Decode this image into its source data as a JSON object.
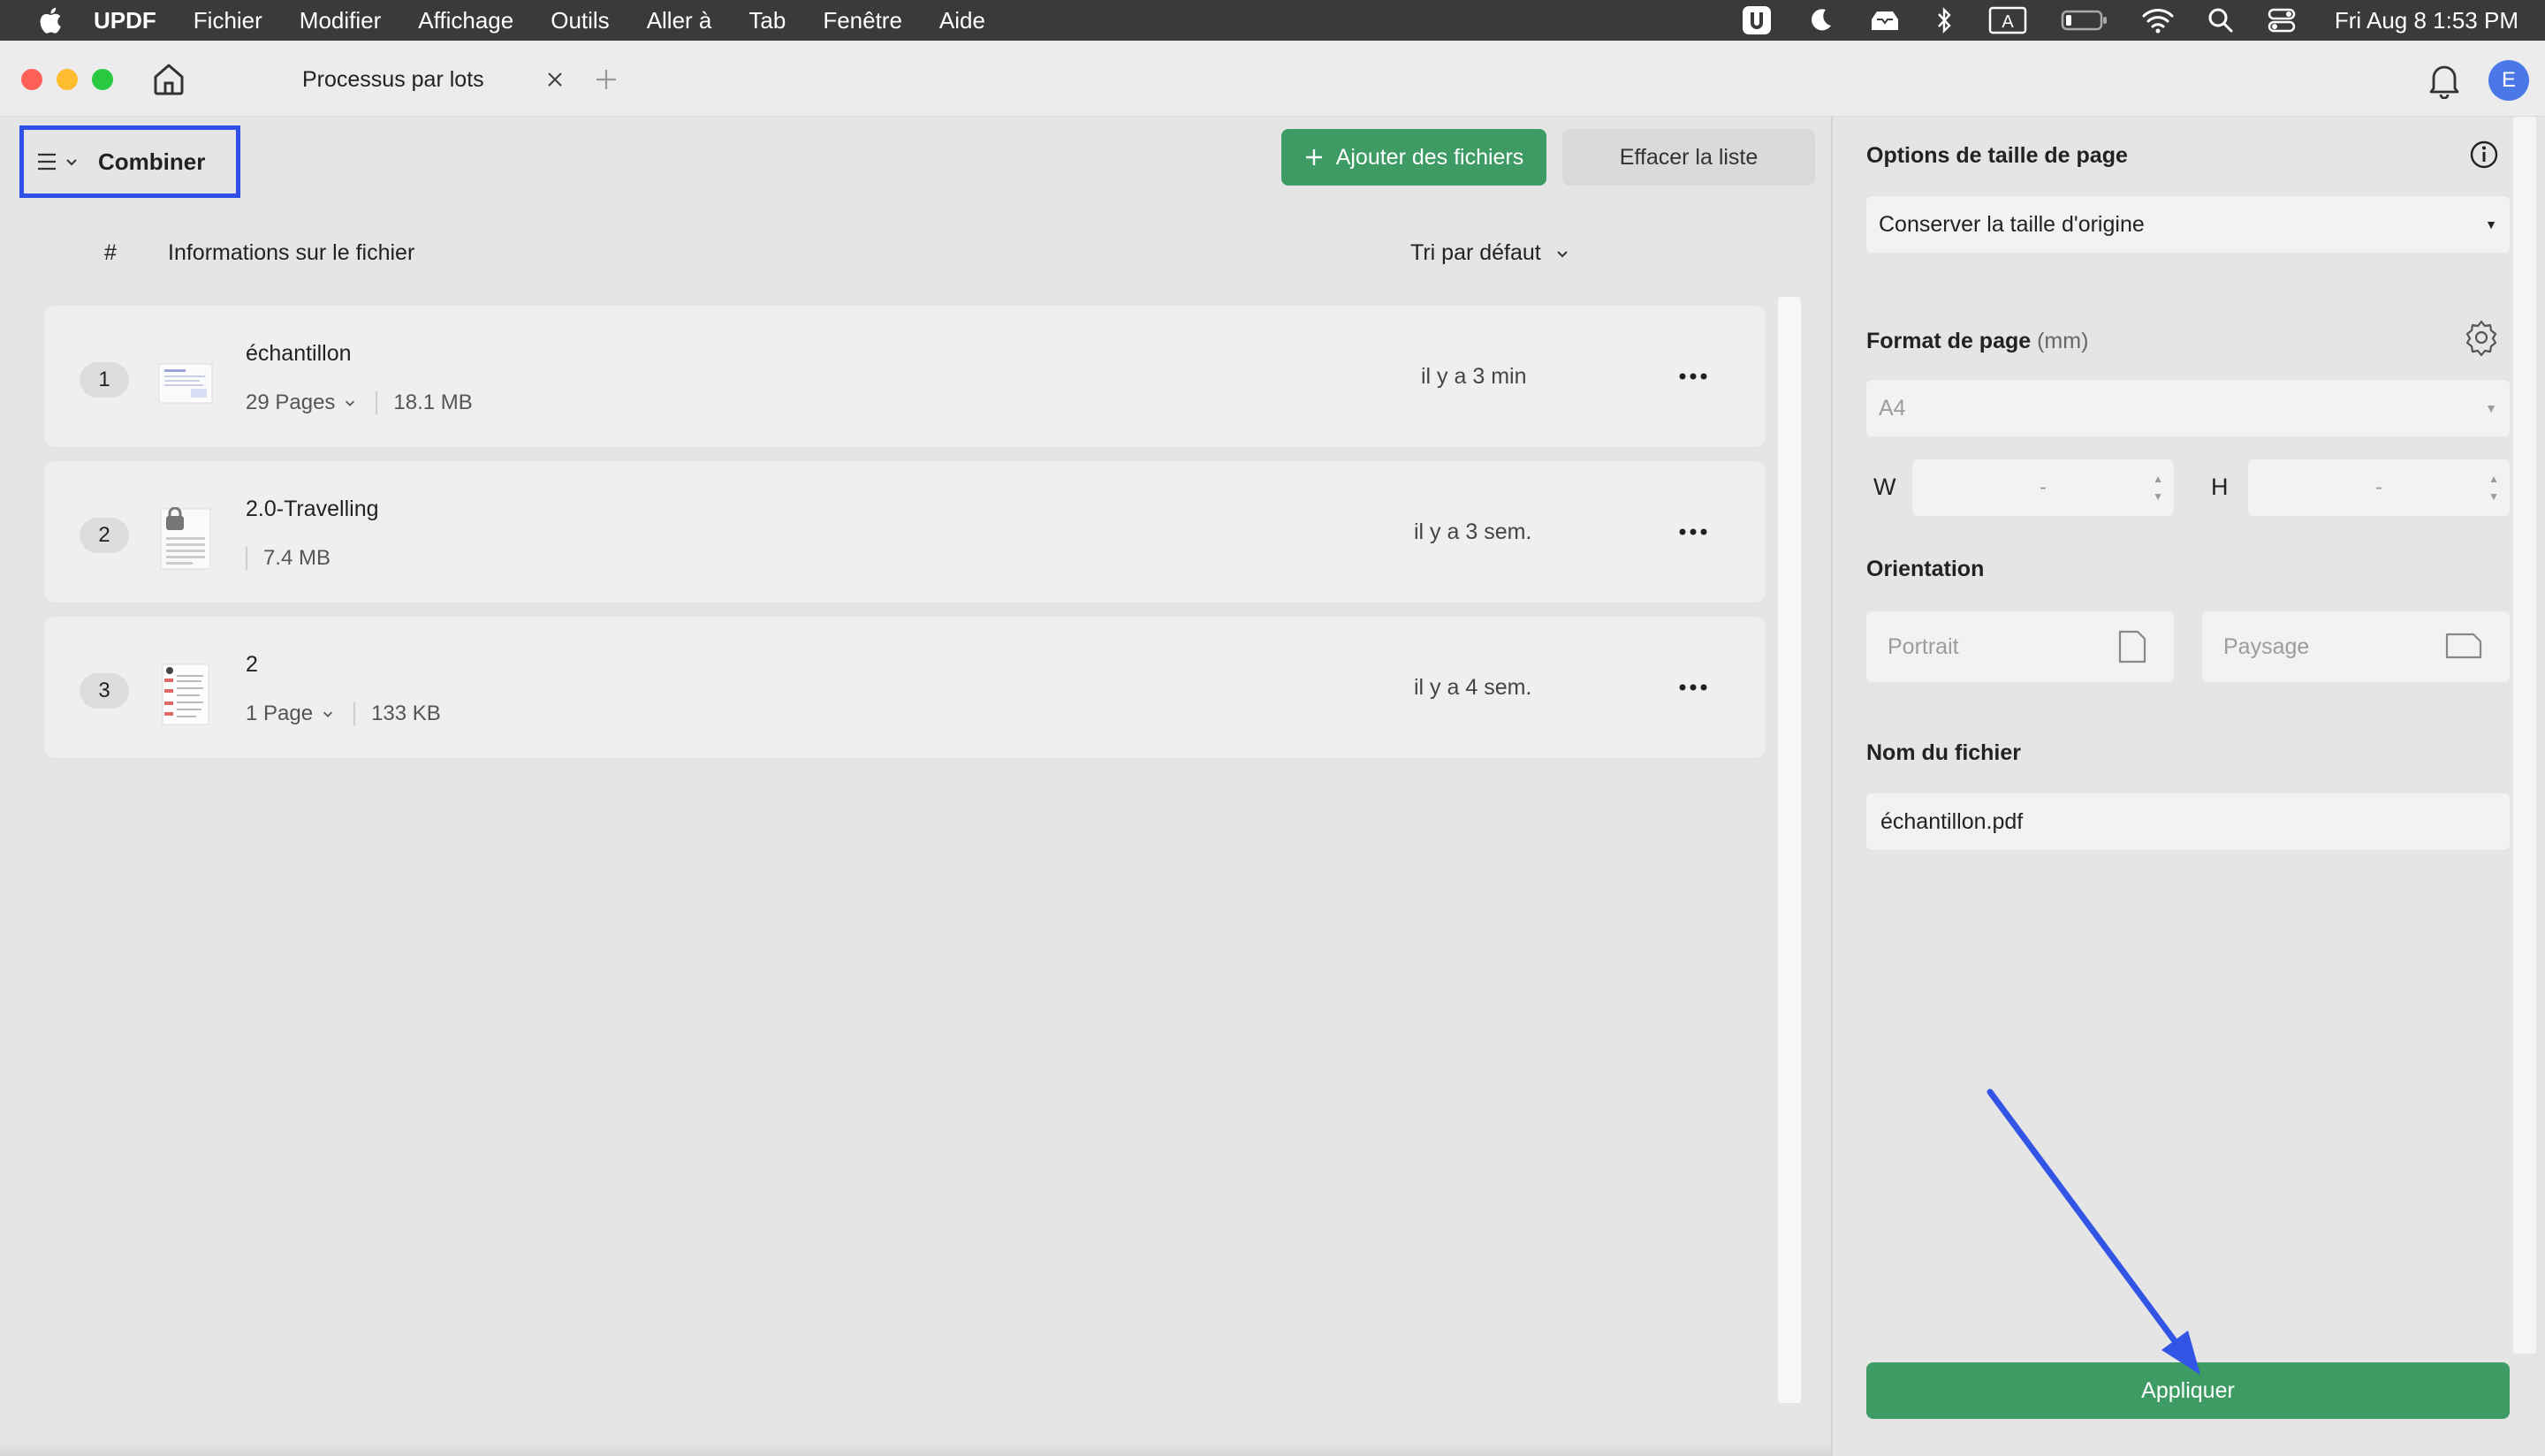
{
  "menubar": {
    "app_name": "UPDF",
    "items": [
      "Fichier",
      "Modifier",
      "Affichage",
      "Outils",
      "Aller à",
      "Tab",
      "Fenêtre",
      "Aide"
    ],
    "clock": "Fri Aug 8  1:53 PM",
    "input_indicator": "A"
  },
  "window": {
    "tab_title": "Processus par lots",
    "avatar_initial": "E"
  },
  "toolbar": {
    "mode_label": "Combiner",
    "add_files_label": "Ajouter des fichiers",
    "clear_list_label": "Effacer la liste"
  },
  "table": {
    "col_number": "#",
    "col_info": "Informations sur le fichier",
    "sort_label": "Tri par défaut",
    "rows": [
      {
        "index": "1",
        "name": "échantillon",
        "pages": "29 Pages",
        "size": "18.1 MB",
        "time": "il y a 3 min"
      },
      {
        "index": "2",
        "name": "2.0-Travelling",
        "pages": "",
        "size": "7.4 MB",
        "time": "il y a 3 sem."
      },
      {
        "index": "3",
        "name": "2",
        "pages": "1 Page",
        "size": "133 KB",
        "time": "il y a 4 sem."
      }
    ]
  },
  "options": {
    "page_size_title": "Options de taille de page",
    "page_size_value": "Conserver la taille d'origine",
    "page_format_title": "Format de page",
    "page_format_unit": "(mm)",
    "page_format_value": "A4",
    "width_label": "W",
    "height_label": "H",
    "width_value": "-",
    "height_value": "-",
    "orientation_title": "Orientation",
    "portrait_label": "Portrait",
    "landscape_label": "Paysage",
    "filename_title": "Nom du fichier",
    "filename_value": "échantillon.pdf",
    "apply_label": "Appliquer"
  },
  "colors": {
    "accent_green": "#3d9b63",
    "highlight_blue": "#2f4ee8",
    "avatar_blue": "#4b78e8"
  }
}
